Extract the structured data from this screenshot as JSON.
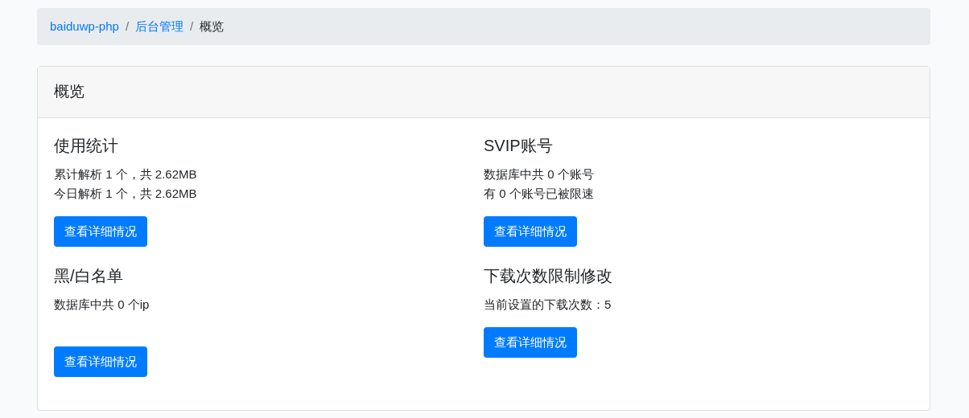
{
  "breadcrumb_separator": "/",
  "breadcrumb": [
    {
      "label": "baiduwp-php",
      "link": true
    },
    {
      "label": "后台管理",
      "link": true
    },
    {
      "label": "概览",
      "link": false
    }
  ],
  "card": {
    "title": "概览",
    "columns": [
      [
        {
          "title": "使用统计",
          "lines": [
            "累计解析 1 个，共 2.62MB",
            "今日解析 1 个，共 2.62MB"
          ],
          "button": "查看详细情况"
        },
        {
          "title": "黑/白名单",
          "lines": [
            "数据库中共 0 个ip"
          ],
          "button": "查看详细情况"
        }
      ],
      [
        {
          "title": "SVIP账号",
          "lines": [
            "数据库中共 0 个账号",
            "有 0 个账号已被限速"
          ],
          "button": "查看详细情况"
        },
        {
          "title": "下载次数限制修改",
          "lines": [
            "当前设置的下载次数：5"
          ],
          "button": "查看详细情况"
        }
      ]
    ]
  }
}
